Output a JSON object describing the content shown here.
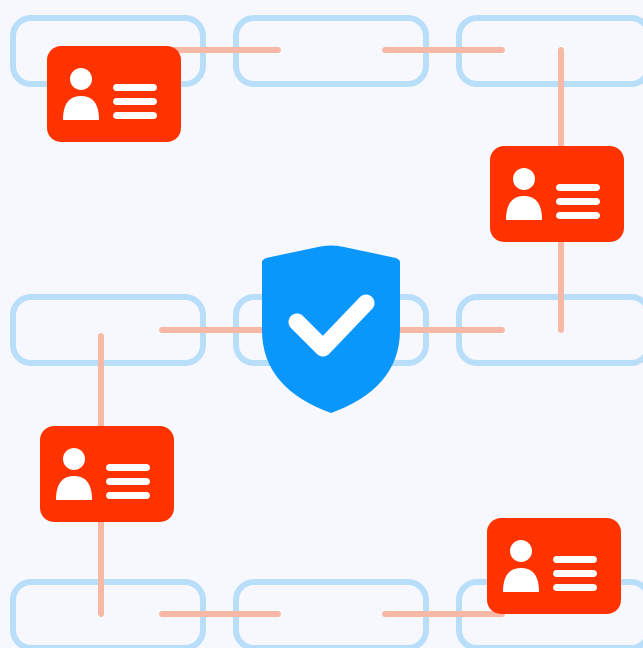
{
  "colors": {
    "background": "#f6f8fd",
    "chain_link": "#b9defa",
    "connector": "#f7b9a5",
    "id_card": "#ff3300",
    "id_card_glyph": "#ffffff",
    "shield": "#0a97fb",
    "checkmark": "#ffffff"
  },
  "icons": {
    "card": "id-card-icon",
    "shield": "shield-check-icon"
  }
}
